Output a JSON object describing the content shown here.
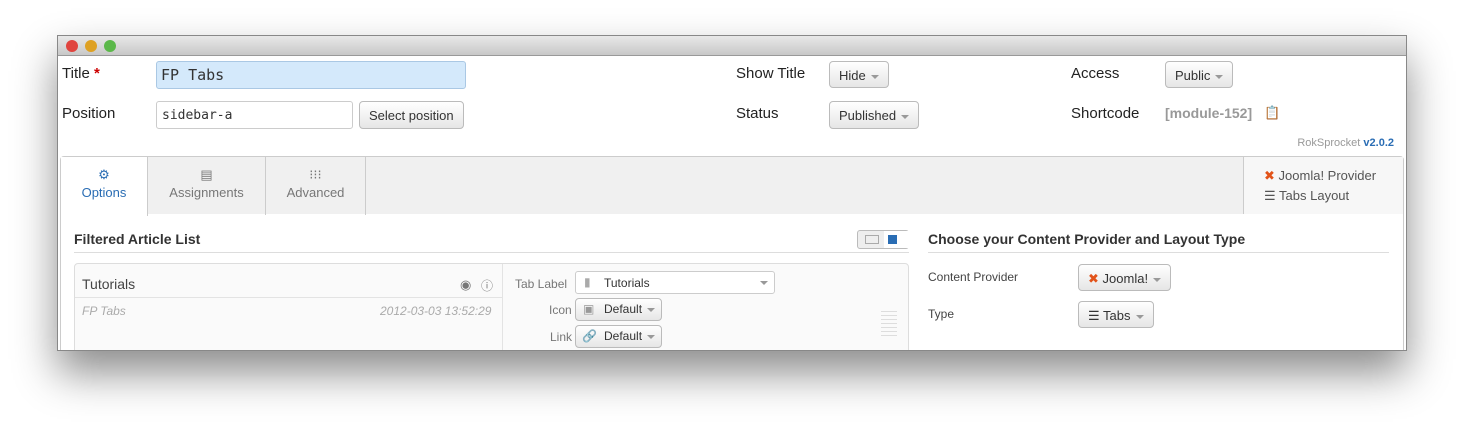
{
  "form": {
    "title_label": "Title",
    "required_mark": "*",
    "title_value": "FP Tabs",
    "position_label": "Position",
    "position_value": "sidebar-a",
    "select_position": "Select position",
    "show_title_label": "Show Title",
    "show_title_value": "Hide",
    "status_label": "Status",
    "status_value": "Published",
    "access_label": "Access",
    "access_value": "Public",
    "shortcode_label": "Shortcode",
    "shortcode_value": "[module-152]"
  },
  "brand": {
    "name": "RokSprocket",
    "version": "v2.0.2"
  },
  "tabs": [
    {
      "label": "Options",
      "active": true
    },
    {
      "label": "Assignments"
    },
    {
      "label": "Advanced"
    }
  ],
  "provider_summary": {
    "provider": "Joomla! Provider",
    "layout": "Tabs Layout"
  },
  "article_list": {
    "heading": "Filtered Article List",
    "item": {
      "title": "Tutorials",
      "subtitle": "FP Tabs",
      "date": "2012-03-03 13:52:29",
      "tab_label_label": "Tab Label",
      "tab_label_value": "Tutorials",
      "icon_label": "Icon",
      "icon_value": "Default",
      "link_label": "Link",
      "link_value": "Default"
    }
  },
  "content_provider": {
    "heading": "Choose your Content Provider and Layout Type",
    "provider_label": "Content Provider",
    "provider_value": "Joomla!",
    "type_label": "Type",
    "type_value": "Tabs"
  },
  "colors": {
    "accent": "#2a6db4",
    "title_input_bg": "#d4e9fb"
  }
}
